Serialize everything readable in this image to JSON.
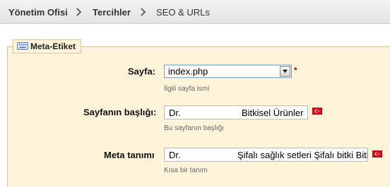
{
  "breadcrumb": {
    "items": [
      {
        "label": "Yönetim Ofisi"
      },
      {
        "label": "Tercihler"
      },
      {
        "label": "SEO & URLs"
      }
    ]
  },
  "section": {
    "legend": "Meta-Etiket",
    "legend_icon": "keyboard-icon"
  },
  "form": {
    "page": {
      "label": "Sayfa:",
      "value": "index.php",
      "required_mark": "*",
      "hint": "İlgili sayfa ismi"
    },
    "title": {
      "label": "Sayfanın başlığı:",
      "value_prefix": "Dr.",
      "value_main": "Bitkisel Ürünler",
      "hint": "Bu sayfanın başlığı",
      "lang_icon": "turkish-flag-icon"
    },
    "description": {
      "label": "Meta tanımı",
      "value_prefix": "Dr.",
      "value_main": "Şifalı sağlık setleri Şifalı bitki Bitki",
      "hint": "Kısa bir tanım",
      "lang_icon": "turkish-flag-icon"
    }
  },
  "colors": {
    "panel_bg": "#fff4da",
    "panel_border": "#d9c69c",
    "required": "#cc0000",
    "flag_red": "#e30a17"
  }
}
